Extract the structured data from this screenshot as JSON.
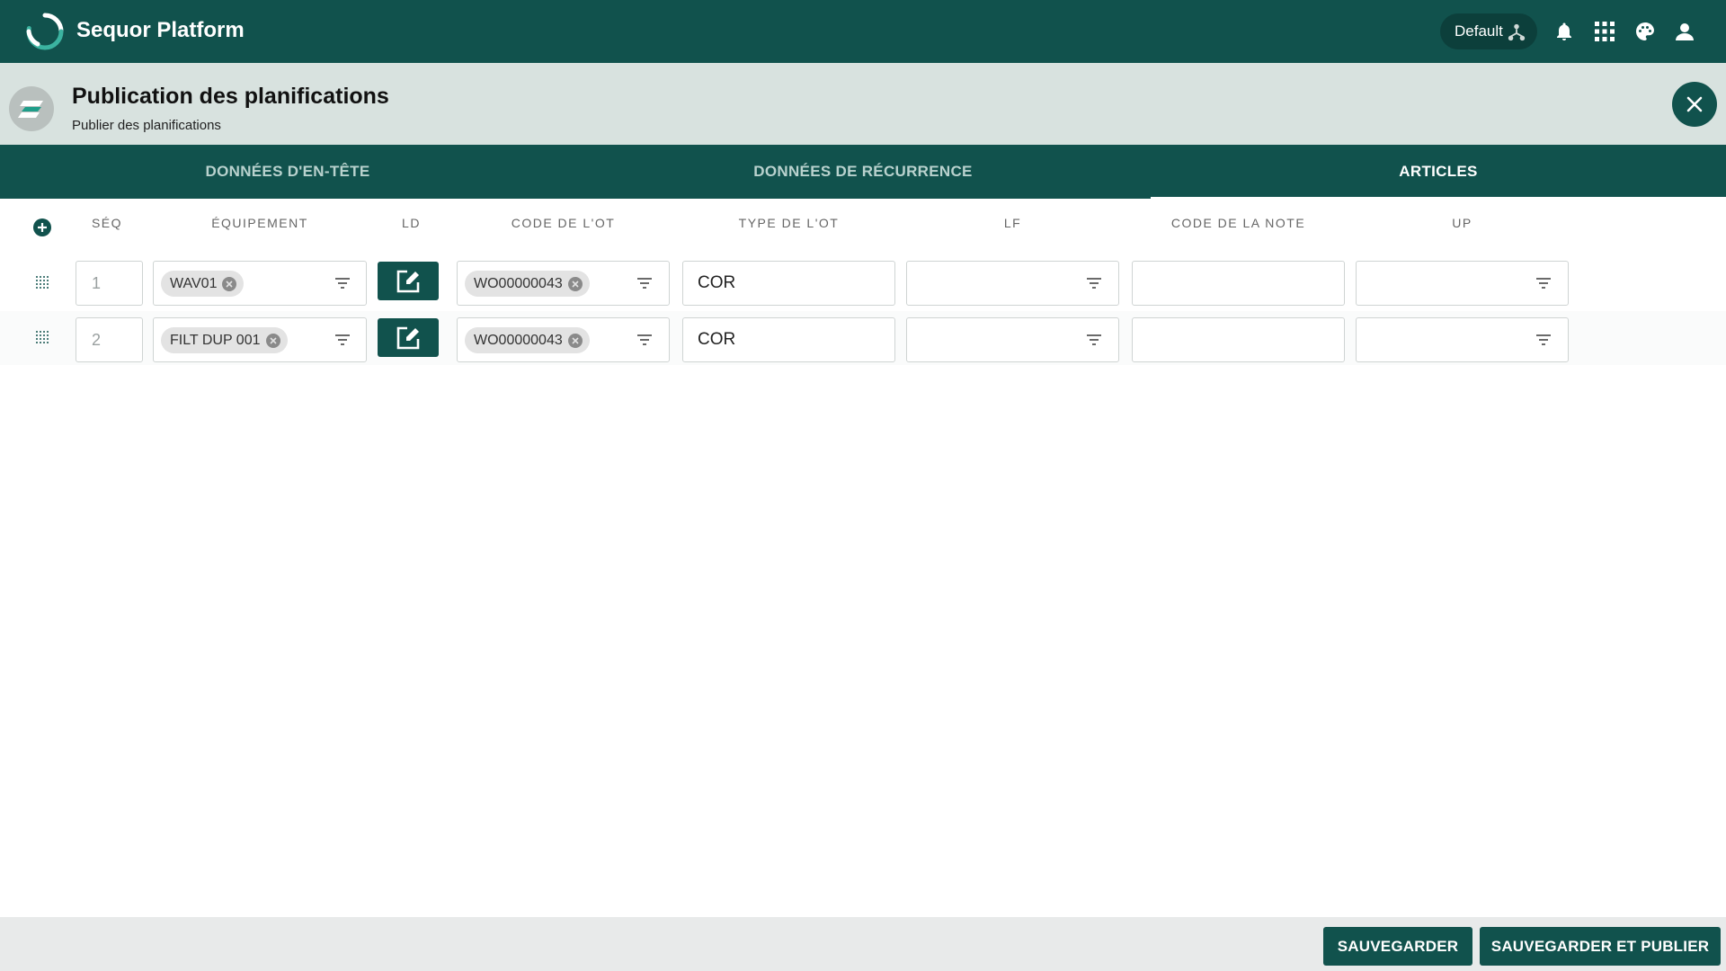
{
  "app": {
    "title": "Sequor Platform",
    "tenant": "Default"
  },
  "page": {
    "title": "Publication des planifications",
    "subtitle": "Publier des planifications"
  },
  "tabs": [
    {
      "label": "DONNÉES D'EN-TÊTE",
      "active": false
    },
    {
      "label": "DONNÉES DE RÉCURRENCE",
      "active": false
    },
    {
      "label": "ARTICLES",
      "active": true
    }
  ],
  "columns": {
    "seq": "SÉQ",
    "equipment": "ÉQUIPEMENT",
    "ld": "LD",
    "wo_code": "CODE DE L'OT",
    "wo_type": "TYPE DE L'OT",
    "lf": "LF",
    "note_code": "CODE DE LA NOTE",
    "up": "UP"
  },
  "rows": [
    {
      "seq": "1",
      "equipment": "WAV01",
      "wo_code": "WO00000043",
      "wo_type": "COR",
      "lf": "",
      "note_code": "",
      "up": ""
    },
    {
      "seq": "2",
      "equipment": "FILT DUP 001",
      "wo_code": "WO00000043",
      "wo_type": "COR",
      "lf": "",
      "note_code": "",
      "up": ""
    }
  ],
  "footer": {
    "save": "SAUVEGARDER",
    "save_publish": "SAUVEGARDER ET PUBLIER"
  },
  "colors": {
    "primary": "#11524d",
    "header_bg": "#d8e2df",
    "accent": "#3bb3a0"
  },
  "icons": [
    "refresh-logo-icon",
    "network-icon",
    "bell-icon",
    "apps-grid-icon",
    "palette-icon",
    "user-icon",
    "close-icon",
    "add-circle-icon",
    "drag-handle-icon",
    "filter-icon",
    "edit-icon"
  ]
}
